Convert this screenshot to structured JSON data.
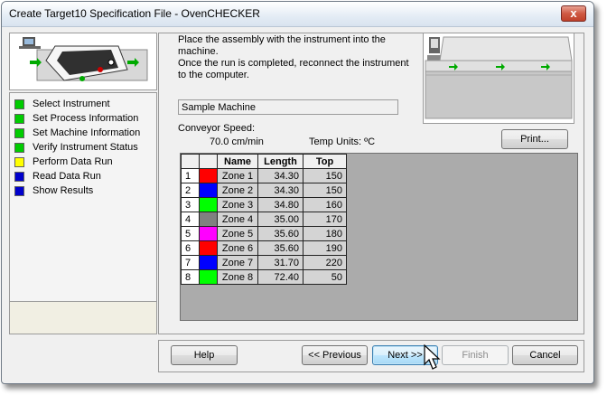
{
  "window": {
    "title": "Create Target10 Specification File - OvenCHECKER",
    "close_glyph": "x"
  },
  "steps": [
    {
      "label": "Select Instrument",
      "color": "#00cc00"
    },
    {
      "label": "Set Process Information",
      "color": "#00cc00"
    },
    {
      "label": "Set Machine Information",
      "color": "#00cc00"
    },
    {
      "label": "Verify Instrument Status",
      "color": "#00cc00"
    },
    {
      "label": "Perform Data Run",
      "color": "#ffff00"
    },
    {
      "label": "Read Data Run",
      "color": "#0000cc"
    },
    {
      "label": "Show Results",
      "color": "#0000cc"
    }
  ],
  "instructions": {
    "line1": "Place the assembly with the instrument into the machine.",
    "line2": "Once the run is completed, reconnect the instrument to the computer."
  },
  "machine_name": "Sample Machine",
  "conveyor": {
    "label": "Conveyor Speed:",
    "value": "70.0 cm/min"
  },
  "temp_units": "Temp Units: ºC",
  "table": {
    "headers": [
      "",
      "",
      "Name",
      "Length",
      "Top"
    ],
    "rows": [
      {
        "num": "1",
        "color": "#ff0000",
        "name": "Zone 1",
        "length": "34.30",
        "top": "150"
      },
      {
        "num": "2",
        "color": "#0000ff",
        "name": "Zone 2",
        "length": "34.30",
        "top": "150"
      },
      {
        "num": "3",
        "color": "#00ff00",
        "name": "Zone 3",
        "length": "34.80",
        "top": "160"
      },
      {
        "num": "4",
        "color": "#808080",
        "name": "Zone 4",
        "length": "35.00",
        "top": "170"
      },
      {
        "num": "5",
        "color": "#ff00ff",
        "name": "Zone 5",
        "length": "35.60",
        "top": "180"
      },
      {
        "num": "6",
        "color": "#ff0000",
        "name": "Zone 6",
        "length": "35.60",
        "top": "190"
      },
      {
        "num": "7",
        "color": "#0000ff",
        "name": "Zone 7",
        "length": "31.70",
        "top": "220"
      },
      {
        "num": "8",
        "color": "#00ff00",
        "name": "Zone 8",
        "length": "72.40",
        "top": "50"
      }
    ]
  },
  "buttons": {
    "print": "Print...",
    "help": "Help",
    "previous": "<< Previous",
    "next": "Next >>",
    "finish": "Finish",
    "cancel": "Cancel"
  }
}
